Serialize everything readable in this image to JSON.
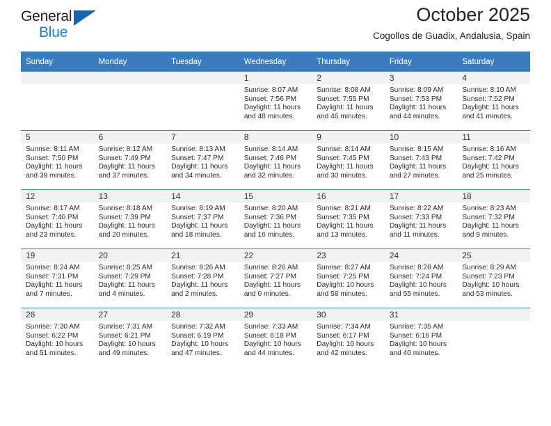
{
  "brand": {
    "name_part1": "General",
    "name_part2": "Blue",
    "triangle_color": "#1566b0",
    "blue_color": "#1c7fd4"
  },
  "header": {
    "month_title": "October 2025",
    "location": "Cogollos de Guadix, Andalusia, Spain"
  },
  "theme": {
    "header_blue": "#3a7cbe",
    "daynum_band": "#f1f1f1",
    "text": "#2b2b2b"
  },
  "weekday_headers": [
    "Sunday",
    "Monday",
    "Tuesday",
    "Wednesday",
    "Thursday",
    "Friday",
    "Saturday"
  ],
  "weeks": [
    [
      {
        "day": "",
        "empty": true,
        "sunrise": "",
        "sunset": "",
        "daylight_line1": "",
        "daylight_line2": ""
      },
      {
        "day": "",
        "empty": true,
        "sunrise": "",
        "sunset": "",
        "daylight_line1": "",
        "daylight_line2": ""
      },
      {
        "day": "",
        "empty": true,
        "sunrise": "",
        "sunset": "",
        "daylight_line1": "",
        "daylight_line2": ""
      },
      {
        "day": "1",
        "empty": false,
        "sunrise": "Sunrise: 8:07 AM",
        "sunset": "Sunset: 7:56 PM",
        "daylight_line1": "Daylight: 11 hours",
        "daylight_line2": "and 48 minutes."
      },
      {
        "day": "2",
        "empty": false,
        "sunrise": "Sunrise: 8:08 AM",
        "sunset": "Sunset: 7:55 PM",
        "daylight_line1": "Daylight: 11 hours",
        "daylight_line2": "and 46 minutes."
      },
      {
        "day": "3",
        "empty": false,
        "sunrise": "Sunrise: 8:09 AM",
        "sunset": "Sunset: 7:53 PM",
        "daylight_line1": "Daylight: 11 hours",
        "daylight_line2": "and 44 minutes."
      },
      {
        "day": "4",
        "empty": false,
        "sunrise": "Sunrise: 8:10 AM",
        "sunset": "Sunset: 7:52 PM",
        "daylight_line1": "Daylight: 11 hours",
        "daylight_line2": "and 41 minutes."
      }
    ],
    [
      {
        "day": "5",
        "empty": false,
        "sunrise": "Sunrise: 8:11 AM",
        "sunset": "Sunset: 7:50 PM",
        "daylight_line1": "Daylight: 11 hours",
        "daylight_line2": "and 39 minutes."
      },
      {
        "day": "6",
        "empty": false,
        "sunrise": "Sunrise: 8:12 AM",
        "sunset": "Sunset: 7:49 PM",
        "daylight_line1": "Daylight: 11 hours",
        "daylight_line2": "and 37 minutes."
      },
      {
        "day": "7",
        "empty": false,
        "sunrise": "Sunrise: 8:13 AM",
        "sunset": "Sunset: 7:47 PM",
        "daylight_line1": "Daylight: 11 hours",
        "daylight_line2": "and 34 minutes."
      },
      {
        "day": "8",
        "empty": false,
        "sunrise": "Sunrise: 8:14 AM",
        "sunset": "Sunset: 7:46 PM",
        "daylight_line1": "Daylight: 11 hours",
        "daylight_line2": "and 32 minutes."
      },
      {
        "day": "9",
        "empty": false,
        "sunrise": "Sunrise: 8:14 AM",
        "sunset": "Sunset: 7:45 PM",
        "daylight_line1": "Daylight: 11 hours",
        "daylight_line2": "and 30 minutes."
      },
      {
        "day": "10",
        "empty": false,
        "sunrise": "Sunrise: 8:15 AM",
        "sunset": "Sunset: 7:43 PM",
        "daylight_line1": "Daylight: 11 hours",
        "daylight_line2": "and 27 minutes."
      },
      {
        "day": "11",
        "empty": false,
        "sunrise": "Sunrise: 8:16 AM",
        "sunset": "Sunset: 7:42 PM",
        "daylight_line1": "Daylight: 11 hours",
        "daylight_line2": "and 25 minutes."
      }
    ],
    [
      {
        "day": "12",
        "empty": false,
        "sunrise": "Sunrise: 8:17 AM",
        "sunset": "Sunset: 7:40 PM",
        "daylight_line1": "Daylight: 11 hours",
        "daylight_line2": "and 23 minutes."
      },
      {
        "day": "13",
        "empty": false,
        "sunrise": "Sunrise: 8:18 AM",
        "sunset": "Sunset: 7:39 PM",
        "daylight_line1": "Daylight: 11 hours",
        "daylight_line2": "and 20 minutes."
      },
      {
        "day": "14",
        "empty": false,
        "sunrise": "Sunrise: 8:19 AM",
        "sunset": "Sunset: 7:37 PM",
        "daylight_line1": "Daylight: 11 hours",
        "daylight_line2": "and 18 minutes."
      },
      {
        "day": "15",
        "empty": false,
        "sunrise": "Sunrise: 8:20 AM",
        "sunset": "Sunset: 7:36 PM",
        "daylight_line1": "Daylight: 11 hours",
        "daylight_line2": "and 16 minutes."
      },
      {
        "day": "16",
        "empty": false,
        "sunrise": "Sunrise: 8:21 AM",
        "sunset": "Sunset: 7:35 PM",
        "daylight_line1": "Daylight: 11 hours",
        "daylight_line2": "and 13 minutes."
      },
      {
        "day": "17",
        "empty": false,
        "sunrise": "Sunrise: 8:22 AM",
        "sunset": "Sunset: 7:33 PM",
        "daylight_line1": "Daylight: 11 hours",
        "daylight_line2": "and 11 minutes."
      },
      {
        "day": "18",
        "empty": false,
        "sunrise": "Sunrise: 8:23 AM",
        "sunset": "Sunset: 7:32 PM",
        "daylight_line1": "Daylight: 11 hours",
        "daylight_line2": "and 9 minutes."
      }
    ],
    [
      {
        "day": "19",
        "empty": false,
        "sunrise": "Sunrise: 8:24 AM",
        "sunset": "Sunset: 7:31 PM",
        "daylight_line1": "Daylight: 11 hours",
        "daylight_line2": "and 7 minutes."
      },
      {
        "day": "20",
        "empty": false,
        "sunrise": "Sunrise: 8:25 AM",
        "sunset": "Sunset: 7:29 PM",
        "daylight_line1": "Daylight: 11 hours",
        "daylight_line2": "and 4 minutes."
      },
      {
        "day": "21",
        "empty": false,
        "sunrise": "Sunrise: 8:26 AM",
        "sunset": "Sunset: 7:28 PM",
        "daylight_line1": "Daylight: 11 hours",
        "daylight_line2": "and 2 minutes."
      },
      {
        "day": "22",
        "empty": false,
        "sunrise": "Sunrise: 8:26 AM",
        "sunset": "Sunset: 7:27 PM",
        "daylight_line1": "Daylight: 11 hours",
        "daylight_line2": "and 0 minutes."
      },
      {
        "day": "23",
        "empty": false,
        "sunrise": "Sunrise: 8:27 AM",
        "sunset": "Sunset: 7:25 PM",
        "daylight_line1": "Daylight: 10 hours",
        "daylight_line2": "and 58 minutes."
      },
      {
        "day": "24",
        "empty": false,
        "sunrise": "Sunrise: 8:28 AM",
        "sunset": "Sunset: 7:24 PM",
        "daylight_line1": "Daylight: 10 hours",
        "daylight_line2": "and 55 minutes."
      },
      {
        "day": "25",
        "empty": false,
        "sunrise": "Sunrise: 8:29 AM",
        "sunset": "Sunset: 7:23 PM",
        "daylight_line1": "Daylight: 10 hours",
        "daylight_line2": "and 53 minutes."
      }
    ],
    [
      {
        "day": "26",
        "empty": false,
        "sunrise": "Sunrise: 7:30 AM",
        "sunset": "Sunset: 6:22 PM",
        "daylight_line1": "Daylight: 10 hours",
        "daylight_line2": "and 51 minutes."
      },
      {
        "day": "27",
        "empty": false,
        "sunrise": "Sunrise: 7:31 AM",
        "sunset": "Sunset: 6:21 PM",
        "daylight_line1": "Daylight: 10 hours",
        "daylight_line2": "and 49 minutes."
      },
      {
        "day": "28",
        "empty": false,
        "sunrise": "Sunrise: 7:32 AM",
        "sunset": "Sunset: 6:19 PM",
        "daylight_line1": "Daylight: 10 hours",
        "daylight_line2": "and 47 minutes."
      },
      {
        "day": "29",
        "empty": false,
        "sunrise": "Sunrise: 7:33 AM",
        "sunset": "Sunset: 6:18 PM",
        "daylight_line1": "Daylight: 10 hours",
        "daylight_line2": "and 44 minutes."
      },
      {
        "day": "30",
        "empty": false,
        "sunrise": "Sunrise: 7:34 AM",
        "sunset": "Sunset: 6:17 PM",
        "daylight_line1": "Daylight: 10 hours",
        "daylight_line2": "and 42 minutes."
      },
      {
        "day": "31",
        "empty": false,
        "sunrise": "Sunrise: 7:35 AM",
        "sunset": "Sunset: 6:16 PM",
        "daylight_line1": "Daylight: 10 hours",
        "daylight_line2": "and 40 minutes."
      },
      {
        "day": "",
        "empty": true,
        "sunrise": "",
        "sunset": "",
        "daylight_line1": "",
        "daylight_line2": ""
      }
    ]
  ]
}
